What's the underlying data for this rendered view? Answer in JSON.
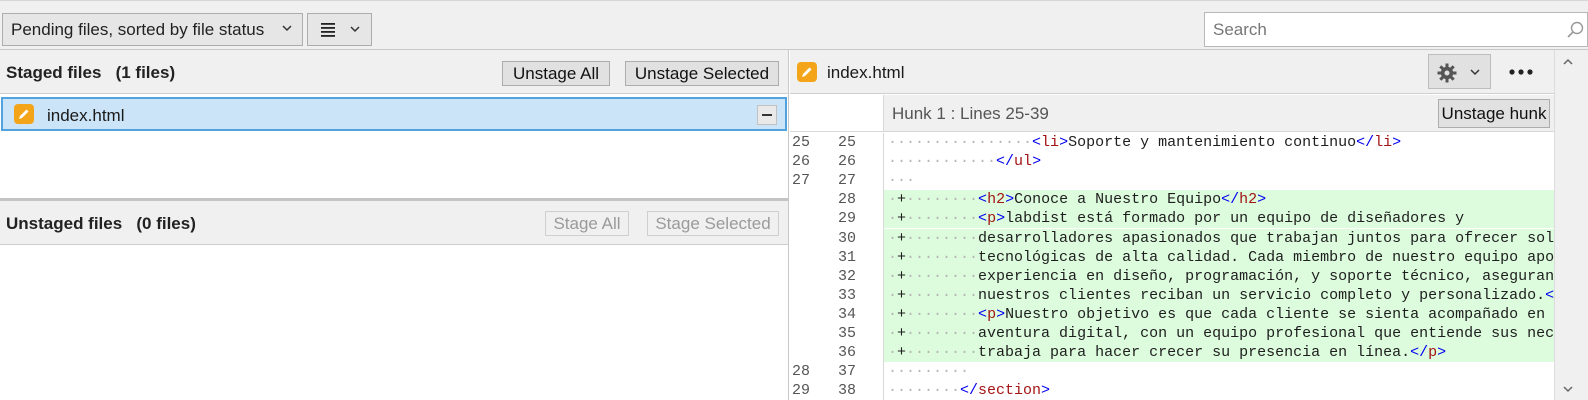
{
  "toolbar": {
    "sort_label": "Pending files, sorted by file status",
    "search_placeholder": "Search"
  },
  "staged": {
    "title": "Staged files   (1 files)",
    "unstage_all": "Unstage All",
    "unstage_selected": "Unstage Selected",
    "files": [
      {
        "name": "index.html",
        "status_icon": "pencil-icon",
        "status_color": "#f4a418"
      }
    ]
  },
  "unstaged": {
    "title": "Unstaged files   (0 files)",
    "stage_all": "Stage All",
    "stage_selected": "Stage Selected"
  },
  "diff": {
    "filename": "index.html",
    "hunk_title": "Hunk 1 : Lines 25-39",
    "unstage_hunk": "Unstage hunk",
    "add_color": "#ddfbdd",
    "lines": [
      {
        "old": "25",
        "new": "25",
        "type": "ctx",
        "ws": "················",
        "sign": "",
        "text": "<li>Soporte y mantenimiento continuo</li>"
      },
      {
        "old": "26",
        "new": "26",
        "type": "ctx",
        "ws": "············",
        "sign": "",
        "text": "</ul>"
      },
      {
        "old": "27",
        "new": "27",
        "type": "ctx",
        "ws": "···",
        "sign": "",
        "text": ""
      },
      {
        "old": "",
        "new": "28",
        "type": "add",
        "ws": "········",
        "sign": "+",
        "text": "<h2>Conoce a Nuestro Equipo</h2>"
      },
      {
        "old": "",
        "new": "29",
        "type": "add",
        "ws": "········",
        "sign": "+",
        "text": "<p>labdist está formado por un equipo de diseñadores y"
      },
      {
        "old": "",
        "new": "30",
        "type": "add",
        "ws": "········",
        "sign": "+",
        "text": "desarrolladores apasionados que trabajan juntos para ofrecer soluciones"
      },
      {
        "old": "",
        "new": "31",
        "type": "add",
        "ws": "········",
        "sign": "+",
        "text": "tecnológicas de alta calidad. Cada miembro de nuestro equipo aporta su"
      },
      {
        "old": "",
        "new": "32",
        "type": "add",
        "ws": "········",
        "sign": "+",
        "text": "experiencia en diseño, programación, y soporte técnico, asegurando que"
      },
      {
        "old": "",
        "new": "33",
        "type": "add",
        "ws": "········",
        "sign": "+",
        "text": "nuestros clientes reciban un servicio completo y personalizado.</p>"
      },
      {
        "old": "",
        "new": "34",
        "type": "add",
        "ws": "········",
        "sign": "+",
        "text": "<p>Nuestro objetivo es que cada cliente se sienta acompañado en su"
      },
      {
        "old": "",
        "new": "35",
        "type": "add",
        "ws": "········",
        "sign": "+",
        "text": "aventura digital, con un equipo profesional que entiende sus necesidades y"
      },
      {
        "old": "",
        "new": "36",
        "type": "add",
        "ws": "········",
        "sign": "+",
        "text": "trabaja para hacer crecer su presencia en línea.</p>"
      },
      {
        "old": "28",
        "new": "37",
        "type": "ctx",
        "ws": "·········",
        "sign": "",
        "text": ""
      },
      {
        "old": "29",
        "new": "38",
        "type": "ctx",
        "ws": "········",
        "sign": "",
        "text": "</section>"
      }
    ]
  }
}
